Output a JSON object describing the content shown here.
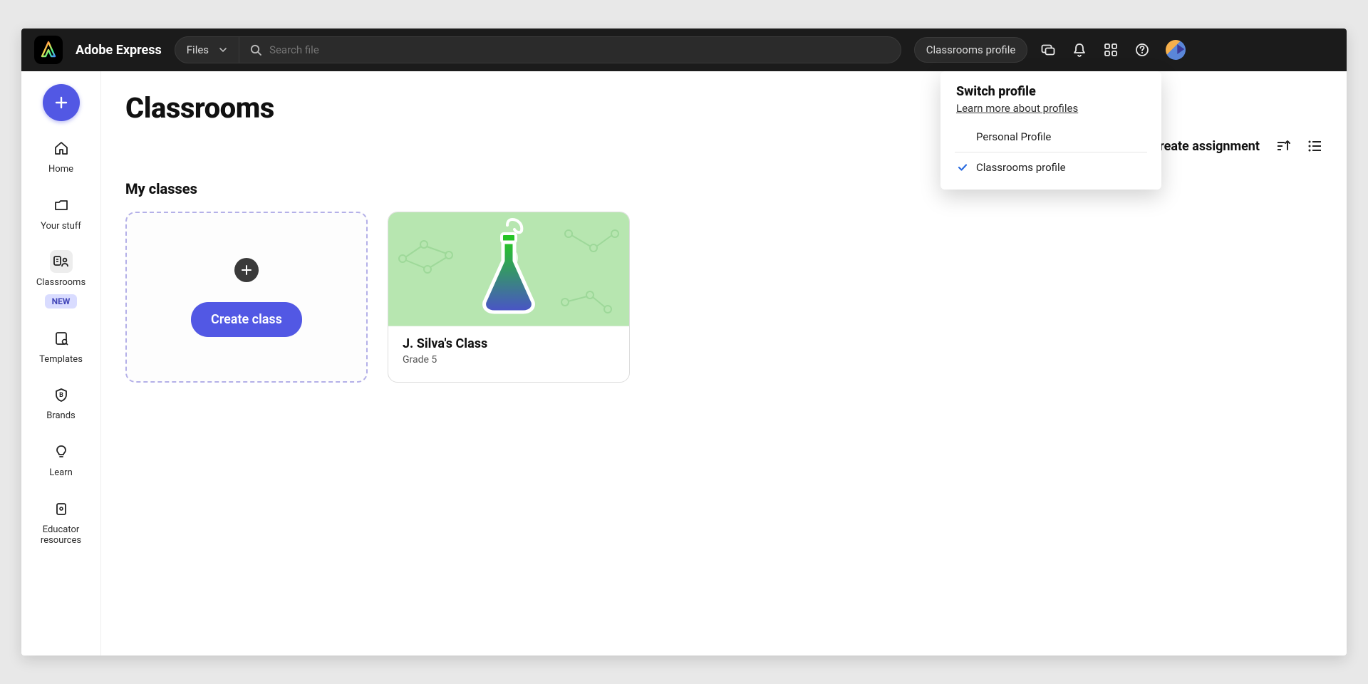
{
  "brand": "Adobe Express",
  "search": {
    "scope": "Files",
    "placeholder": "Search file"
  },
  "profile_chip": "Classrooms profile",
  "sidebar": {
    "items": [
      {
        "label": "Home"
      },
      {
        "label": "Your stuff"
      },
      {
        "label": "Classrooms",
        "badge": "NEW"
      },
      {
        "label": "Templates"
      },
      {
        "label": "Brands"
      },
      {
        "label": "Learn"
      },
      {
        "label": "Educator\nresources"
      }
    ]
  },
  "page": {
    "title": "Classrooms",
    "section": "My classes",
    "create_card": "Create class",
    "create_assignment": "Create assignment"
  },
  "class_card": {
    "name": "J. Silva's Class",
    "grade": "Grade 5"
  },
  "dropdown": {
    "title": "Switch profile",
    "learn_more": "Learn more about profiles",
    "options": [
      {
        "label": "Personal Profile",
        "selected": false
      },
      {
        "label": "Classrooms profile",
        "selected": true
      }
    ]
  }
}
